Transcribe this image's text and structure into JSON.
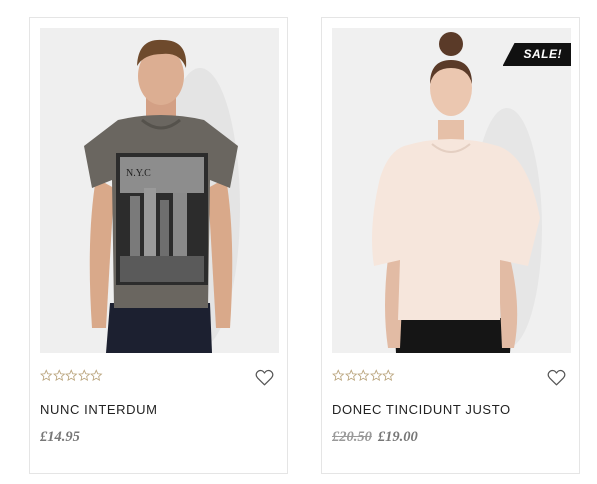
{
  "products": [
    {
      "name": "NUNC INTERDUM",
      "price": "£14.95",
      "old_price": "",
      "badge": "",
      "rating_stars": 0,
      "rating_max": 5,
      "shirt_print": "N.Y.C",
      "image": "man-gray-nyc-tshirt"
    },
    {
      "name": "DONEC TINCIDUNT JUSTO",
      "price": "£19.00",
      "old_price": "£20.50",
      "badge": "SALE!",
      "rating_stars": 0,
      "rating_max": 5,
      "image": "woman-cream-top"
    }
  ],
  "colors": {
    "star": "#b8a27a",
    "badge_bg": "#111111",
    "border": "#e5e5e5",
    "price": "#777777"
  },
  "icons": {
    "rating": "star-outline-icon",
    "wishlist": "heart-outline-icon"
  }
}
